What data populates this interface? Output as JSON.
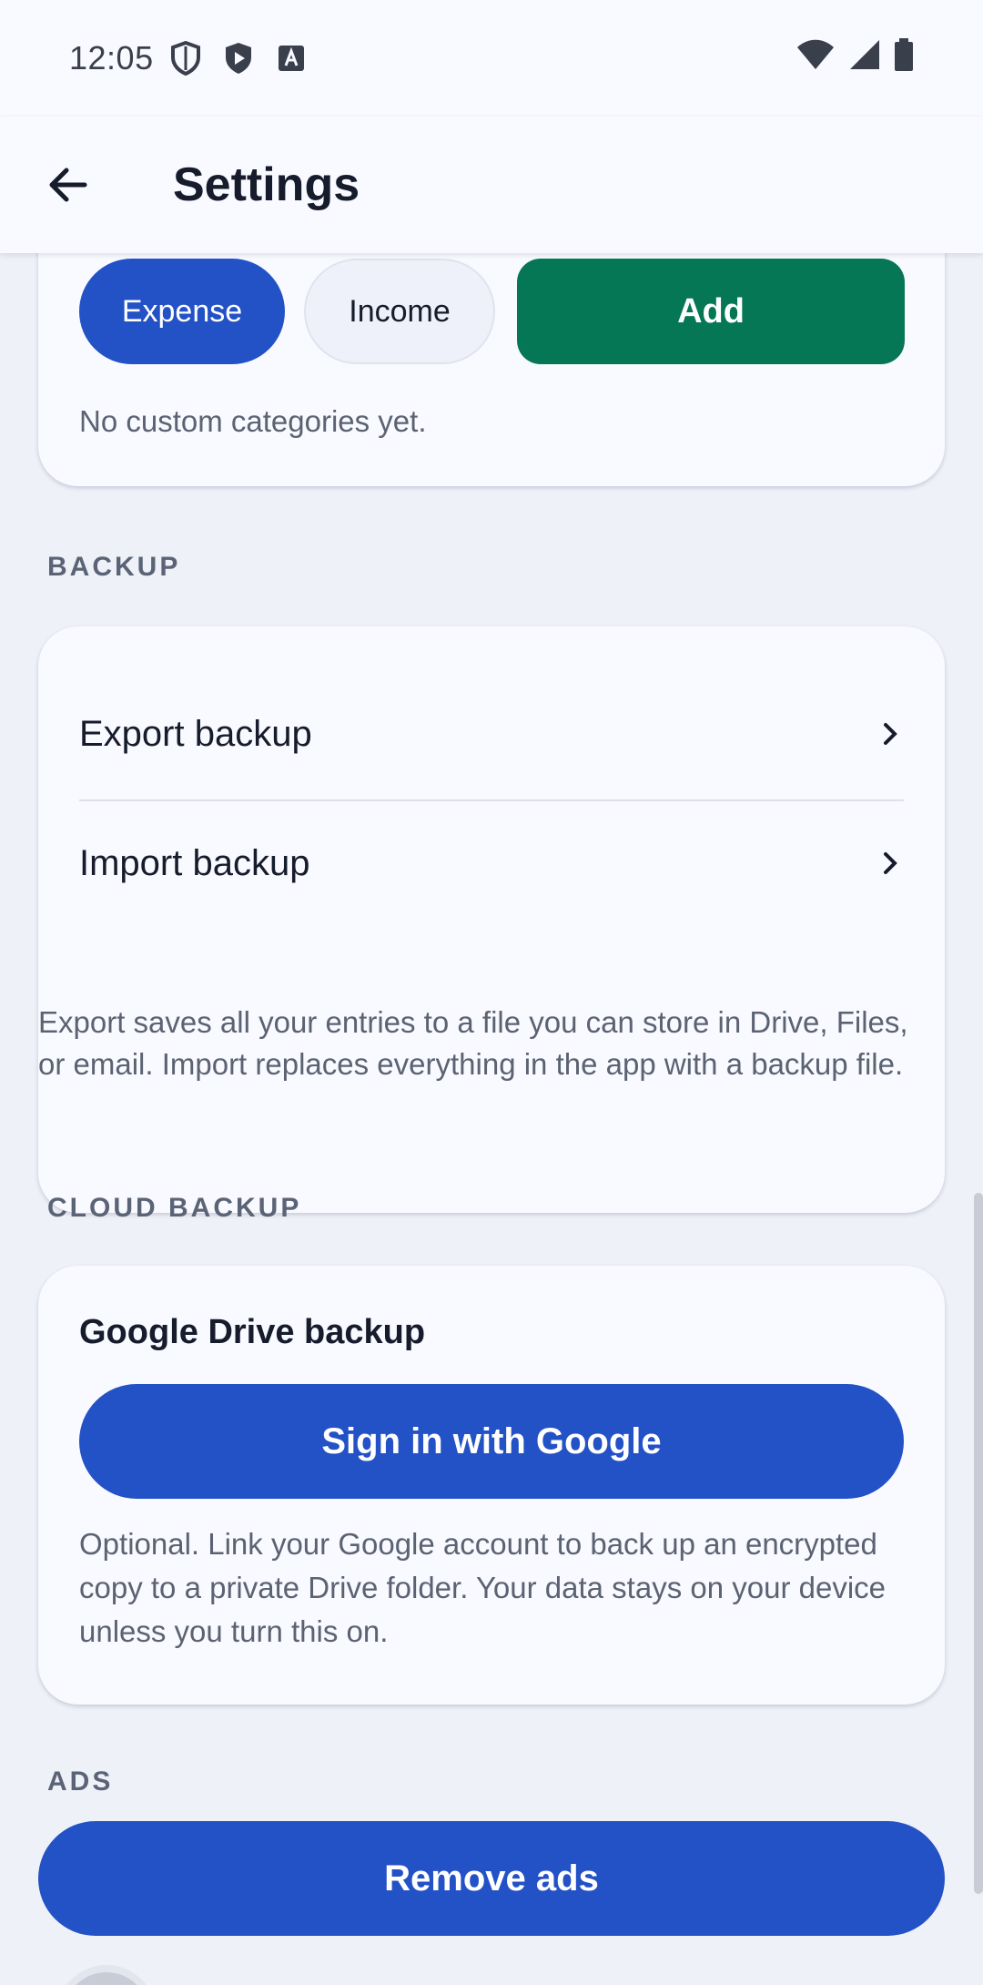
{
  "status_bar": {
    "time": "12:05",
    "icons": [
      "shield-outline-icon",
      "shield-play-icon",
      "font-a-icon"
    ],
    "right_icons": [
      "wifi-icon",
      "signal-icon",
      "battery-icon"
    ]
  },
  "app_bar": {
    "title": "Settings",
    "back_icon": "arrow-back-icon"
  },
  "categories": {
    "type_chips": [
      {
        "label": "Expense",
        "selected": true
      },
      {
        "label": "Income",
        "selected": false
      }
    ],
    "add_label": "Add",
    "empty_text": "No custom categories yet."
  },
  "backup": {
    "section_label": "BACKUP",
    "items": [
      {
        "label": "Export backup"
      },
      {
        "label": "Import backup"
      }
    ],
    "help_text": "Export saves all your entries to a file you can store in Drive, Files, or email. Import replaces everything in the app with a backup file."
  },
  "cloud_backup": {
    "section_label": "CLOUD BACKUP",
    "title": "Google Drive backup",
    "button_label": "Sign in with Google",
    "note": "Optional. Link your Google account to back up an encrypted copy to a private Drive folder. Your data stays on your device unless you turn this on."
  },
  "ads": {
    "section_label": "ADS",
    "button_label": "Remove ads"
  },
  "colors": {
    "primary": "#2351c6",
    "add_green": "#057754",
    "background": "#eef1f8",
    "surface": "#f9faff"
  }
}
